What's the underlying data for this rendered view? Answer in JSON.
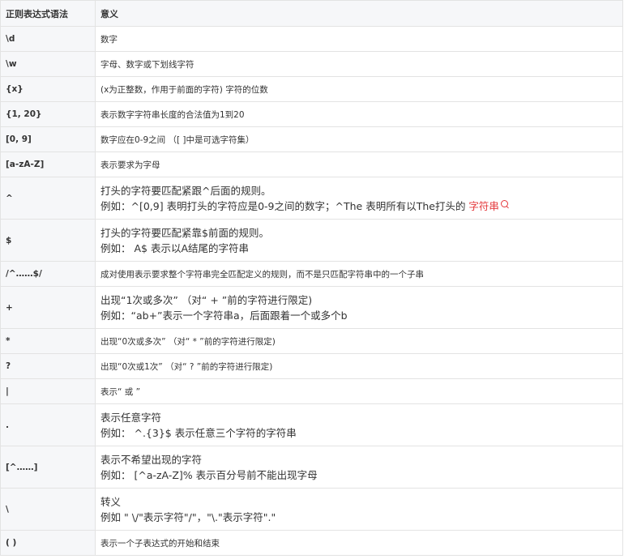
{
  "header": {
    "syntax": "正则表达式语法",
    "meaning": "意义"
  },
  "rows": [
    {
      "syntax": "\\d",
      "meaning": "数字"
    },
    {
      "syntax": "\\w",
      "meaning": "字母、数字或下划线字符"
    },
    {
      "syntax": "{x}",
      "meaning": "(x为正整数，作用于前面的字符) 字符的位数"
    },
    {
      "syntax": "{1, 20}",
      "meaning": "表示数字字符串长度的合法值为1到20"
    },
    {
      "syntax": "[0, 9]",
      "meaning": "数字应在0-9之间 （[ ]中是可选字符集）"
    },
    {
      "syntax": "[a-zA-Z]",
      "meaning": "表示要求为字母"
    },
    {
      "syntax": "^",
      "line1": "打头的字符要匹配紧跟^后面的规则。",
      "line2_prefix": "例如：^[0,9] 表明打头的字符应是0-9之间的数字；^The 表明所有以The打头的 ",
      "line2_link": "字符串"
    },
    {
      "syntax": "$",
      "line1": "打头的字符要匹配紧靠$前面的规则。",
      "line2": "例如： A$ 表示以A结尾的字符串"
    },
    {
      "syntax": "/^……$/",
      "meaning": "成对使用表示要求整个字符串完全匹配定义的规则，而不是只匹配字符串中的一个子串"
    },
    {
      "syntax": "+",
      "line1": "出现“1次或多次” （对“ + ”前的字符进行限定)",
      "line2": "例如：“ab+”表示一个字符串a，后面跟着一个或多个b"
    },
    {
      "syntax": "*",
      "meaning": "出现“0次或多次” （对“ * ”前的字符进行限定)"
    },
    {
      "syntax": "?",
      "meaning": "出现“0次或1次” （对“ ? ”前的字符进行限定)"
    },
    {
      "syntax": "|",
      "meaning": "表示“ 或 ”"
    },
    {
      "syntax": ".",
      "line1": "表示任意字符",
      "line2": "例如： ^.{3}$ 表示任意三个字符的字符串"
    },
    {
      "syntax": "[^……]",
      "line1": "表示不希望出现的字符",
      "line2": "例如： [^a-zA-Z]% 表示百分号前不能出现字母"
    },
    {
      "syntax": "\\",
      "line1": "转义",
      "line2": "例如 \" \\/\"表示字符\"/\"，\"\\.\"表示字符\".\""
    },
    {
      "syntax": "( )",
      "meaning": "表示一个子表达式的开始和结束"
    }
  ]
}
